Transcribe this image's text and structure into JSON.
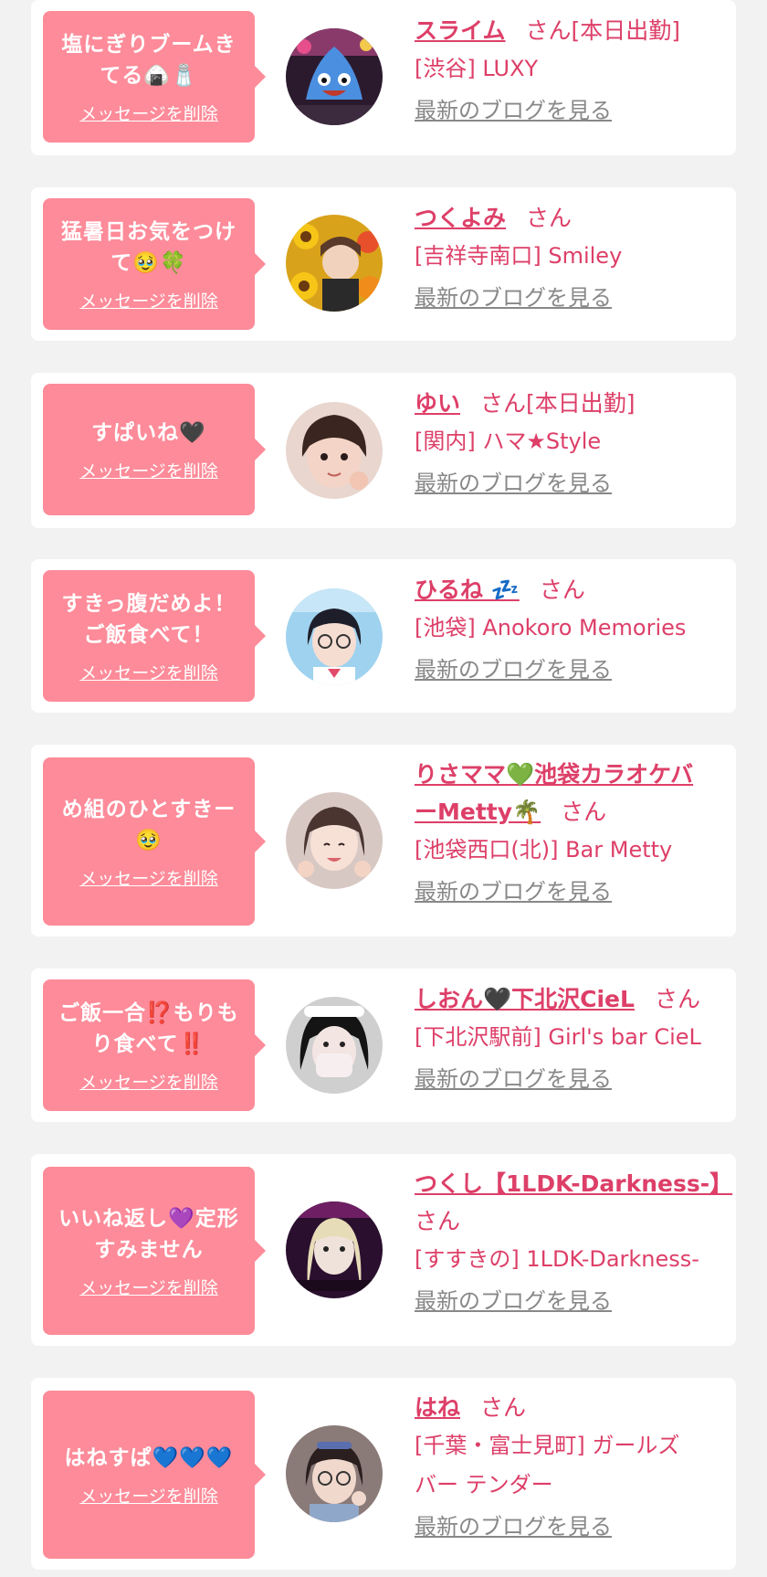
{
  "delete_label": "メッセージを削除",
  "san_label": "さん",
  "blog_label": "最新のブログを見る",
  "theme": {
    "background": "#f2f2f2",
    "bubble": "#fd8b99",
    "accent": "#dd3f68",
    "link_gray": "#888888"
  },
  "cards": [
    {
      "message": [
        "塩にぎりブームき",
        "てる🍙🧂"
      ],
      "name": [
        "スライム"
      ],
      "status": "[本日出勤]",
      "shop": [
        "[渋谷] LUXY"
      ]
    },
    {
      "message": [
        "猛暑日お気をつけ",
        "て🥹🍀"
      ],
      "name": [
        "つくよみ"
      ],
      "status": "",
      "shop": [
        "[吉祥寺南口] Smiley"
      ]
    },
    {
      "message": [
        "すぱいね🖤"
      ],
      "name": [
        "ゆい"
      ],
      "status": "[本日出勤]",
      "shop": [
        "[関内] ハマ★Style"
      ]
    },
    {
      "message": [
        "すきっ腹だめよ！",
        "ご飯食べて！"
      ],
      "name": [
        "ひるね 💤"
      ],
      "status": "",
      "shop": [
        "[池袋] Anokoro Memories"
      ]
    },
    {
      "message": [
        "め組のひとすきー",
        "🥹"
      ],
      "name": [
        "りさママ💚池袋カラオケバ",
        "ーMetty🌴"
      ],
      "status": "",
      "shop": [
        "[池袋西口(北)] Bar Metty"
      ]
    },
    {
      "message": [
        "ご飯一合⁉️もりも",
        "り食べて‼️"
      ],
      "name": [
        "しおん🖤下北沢CieL"
      ],
      "status": "",
      "shop": [
        "[下北沢駅前] Girl's bar CieL"
      ]
    },
    {
      "message": [
        "いいね返し💜定形",
        "すみません"
      ],
      "name": [
        "つくし【1LDK-Darkness-】"
      ],
      "status": "",
      "shop": [
        "[すすきの] 1LDK-Darkness-"
      ]
    },
    {
      "message": [
        "はねすぱ💙💙💙"
      ],
      "name": [
        "はね"
      ],
      "status": "",
      "shop": [
        "[千葉・富士見町] ガールズ",
        "バー テンダー"
      ]
    }
  ]
}
